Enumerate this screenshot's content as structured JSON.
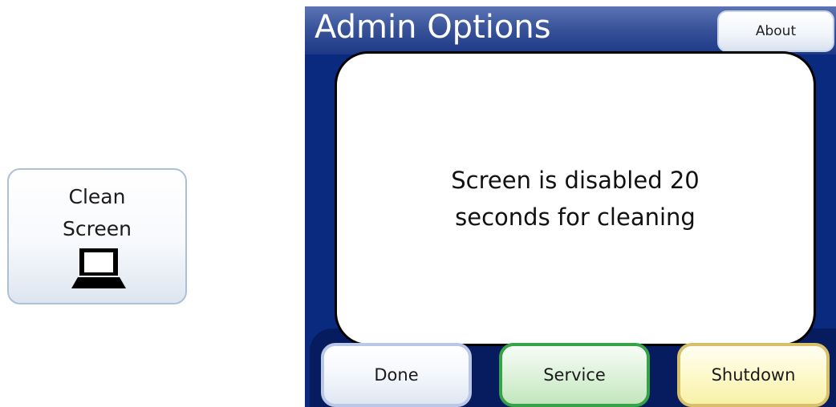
{
  "tile": {
    "label_line1": "Clean",
    "label_line2": "Screen",
    "icon": "laptop-icon"
  },
  "panel": {
    "title": "Admin Options",
    "about_label": "About",
    "dialog": {
      "line1": "Screen is disabled 20",
      "line2": "seconds for cleaning"
    },
    "buttons": {
      "done": "Done",
      "service": "Service",
      "shutdown": "Shutdown"
    }
  },
  "colors": {
    "panel_background": "#0a2a80",
    "title_bar": "#3a549b",
    "service_border": "#37a248",
    "shutdown_border": "#d8c06a",
    "done_border": "#b9c8e6"
  }
}
